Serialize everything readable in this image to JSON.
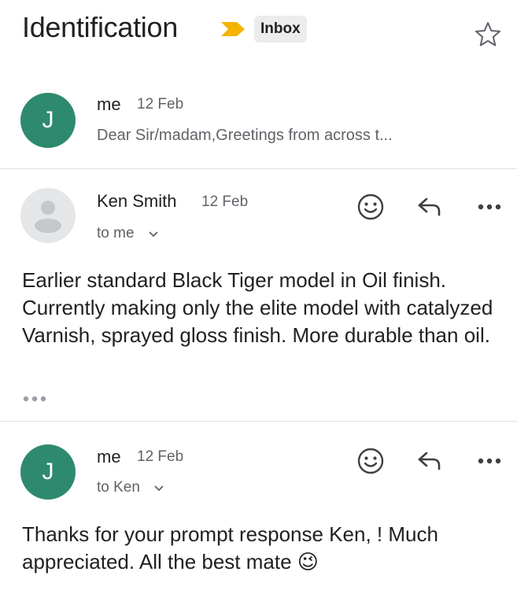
{
  "header": {
    "subject": "Identification",
    "label": "Inbox",
    "important_icon": "important-marker-icon",
    "star_icon": "star-outline-icon"
  },
  "messages": [
    {
      "avatar_initial": "J",
      "sender": "me",
      "date": "12 Feb",
      "snippet": "Dear Sir/madam,Greetings from across t..."
    },
    {
      "avatar_initial": "",
      "sender": "Ken Smith",
      "date": "12 Feb",
      "recipient": "to me",
      "body": "Earlier standard Black Tiger model in Oil finish. Currently making only the elite model with catalyzed Varnish, sprayed gloss finish. More durable than oil."
    },
    {
      "avatar_initial": "J",
      "sender": "me",
      "date": "12 Feb",
      "recipient": "to Ken",
      "body": "Thanks for your prompt response Ken, ! Much appreciated. All the best mate 😉"
    }
  ],
  "icons": {
    "emoji": "smiley-icon",
    "reply": "reply-icon",
    "more": "more-options-icon"
  },
  "colors": {
    "avatar_me": "#2e8a6e",
    "avatar_contact": "#e4e6e8",
    "important": "#f4b400"
  }
}
